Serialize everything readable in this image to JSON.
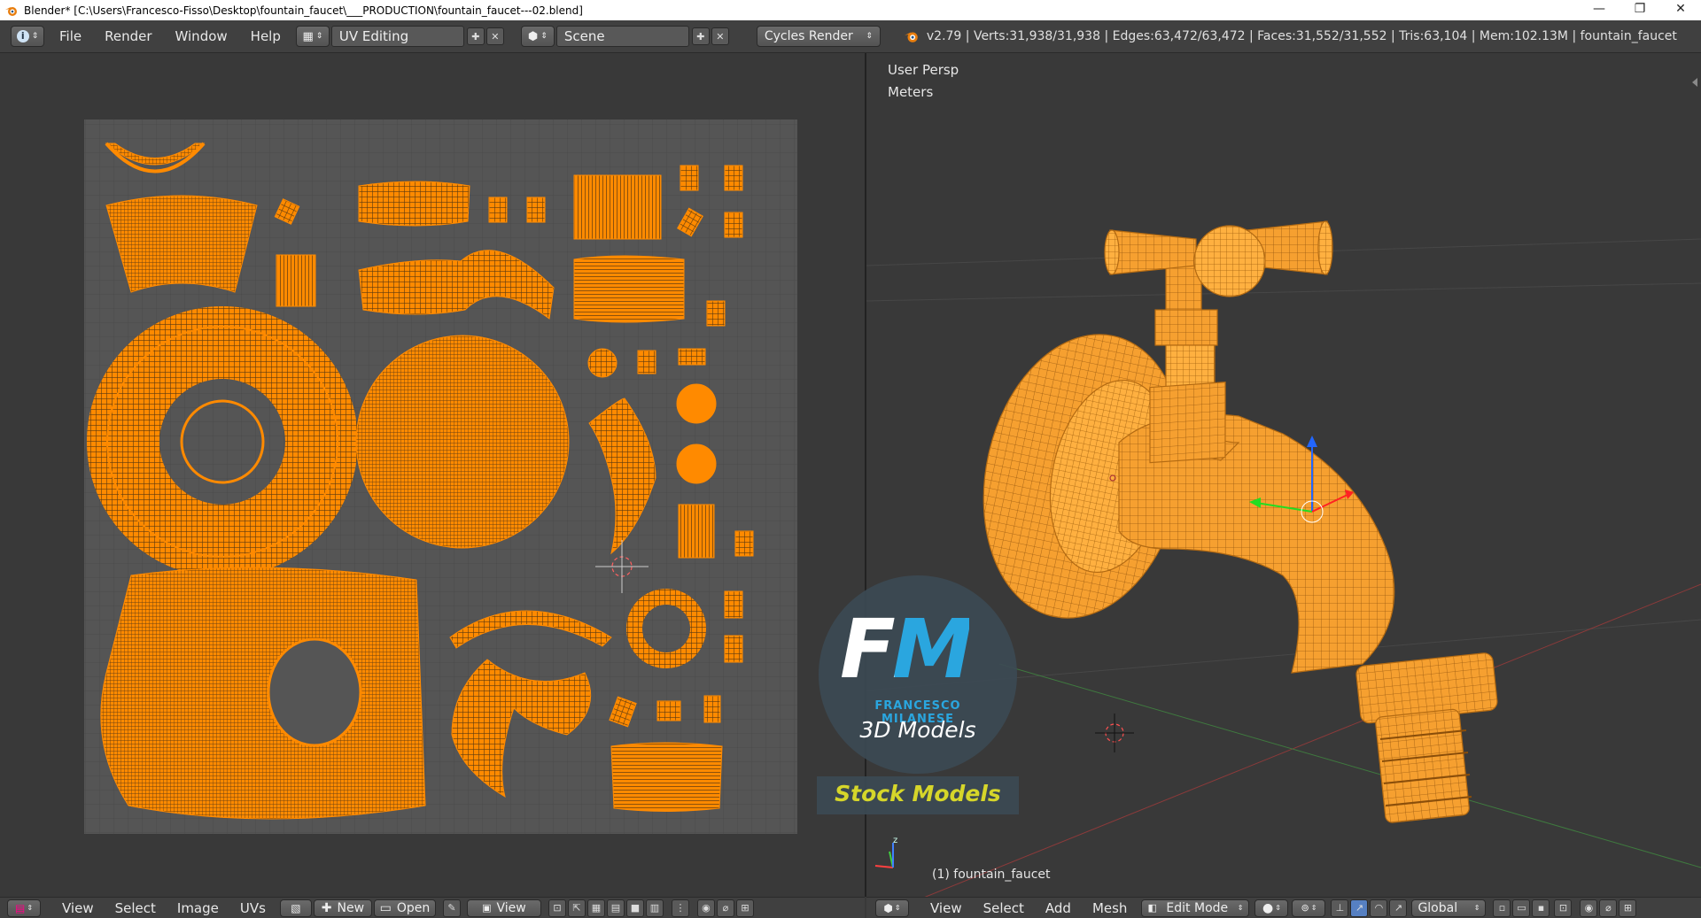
{
  "window": {
    "title": "Blender* [C:\\Users\\Francesco-Fisso\\Desktop\\fountain_faucet\\___PRODUCTION\\fountain_faucet---02.blend]",
    "controls": [
      "—",
      "❐",
      "✕"
    ]
  },
  "topbar": {
    "menus": [
      "File",
      "Render",
      "Window",
      "Help"
    ],
    "screen_layout": "UV Editing",
    "scene": "Scene",
    "render_engine": "Cycles Render",
    "stats": "v2.79 | Verts:31,938/31,938 | Edges:63,472/63,472 | Faces:31,552/31,552 | Tris:63,104 | Mem:102.13M | fountain_faucet"
  },
  "uv_editor": {
    "menus": [
      "View",
      "Select",
      "Image",
      "UVs"
    ],
    "new_label": "New",
    "open_label": "Open",
    "view_label": "View"
  },
  "viewport": {
    "view_name": "User Persp",
    "units": "Meters",
    "object_label": "(1) fountain_faucet",
    "menus": [
      "View",
      "Select",
      "Add",
      "Mesh"
    ],
    "mode": "Edit Mode",
    "orientation": "Global"
  },
  "watermark": {
    "brand_line": "FRANCESCO MILANESE",
    "subtitle": "3D Models",
    "banner": "Stock Models",
    "logo_letters": "FM"
  },
  "colors": {
    "accent_orange": "#ff8a00",
    "panel_bg": "#393939",
    "header_bg": "#404040",
    "watermark_yellow": "#d6d62a",
    "logo_blue": "#2aa6df"
  }
}
